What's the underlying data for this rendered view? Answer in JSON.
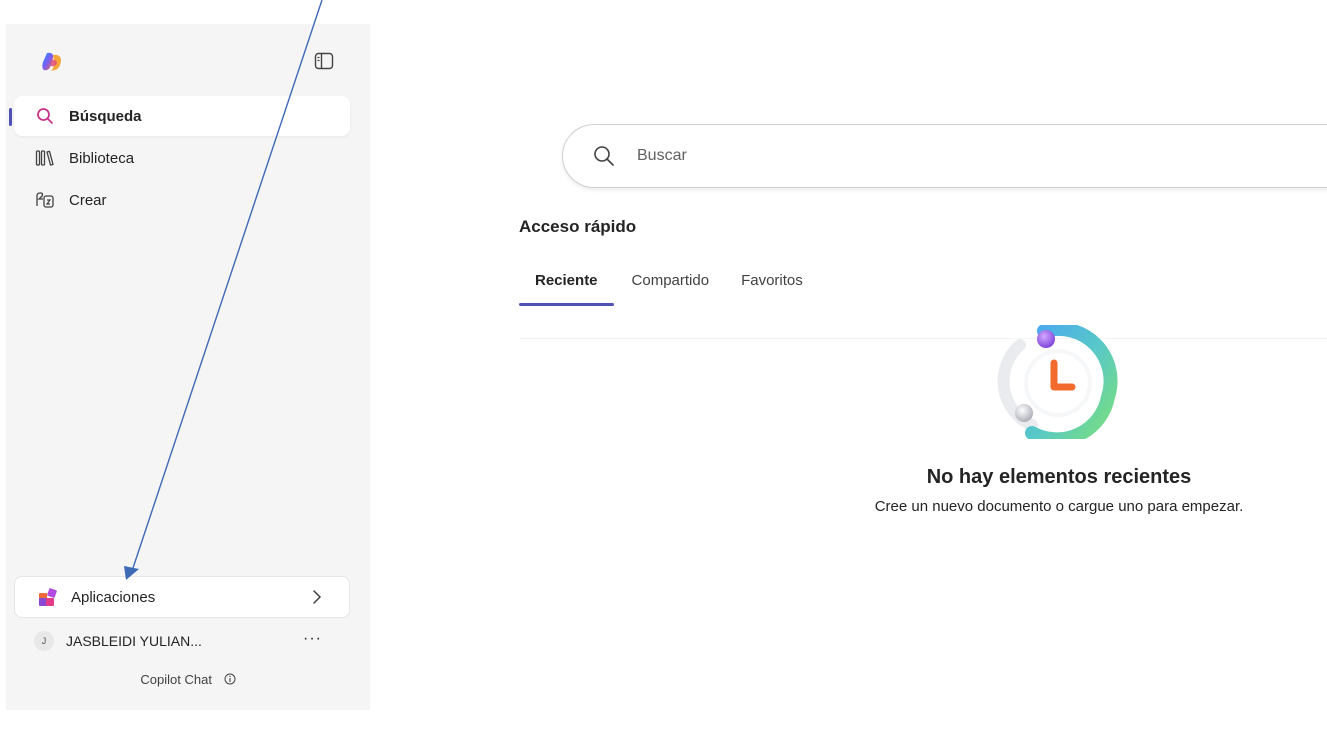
{
  "sidebar": {
    "nav": [
      {
        "label": "Búsqueda",
        "icon": "search-icon"
      },
      {
        "label": "Biblioteca",
        "icon": "library-icon"
      },
      {
        "label": "Crear",
        "icon": "create-icon"
      }
    ],
    "apps_label": "Aplicaciones",
    "user": {
      "initial": "J",
      "name": "JASBLEIDI YULIAN..."
    },
    "footer": "Copilot Chat"
  },
  "main": {
    "search_placeholder": "Buscar",
    "quick_access_title": "Acceso rápido",
    "tabs": [
      {
        "label": "Reciente",
        "active": true
      },
      {
        "label": "Compartido",
        "active": false
      },
      {
        "label": "Favoritos",
        "active": false
      }
    ],
    "empty": {
      "title": "No hay elementos recientes",
      "subtitle": "Cree un nuevo documento o cargue uno para empezar."
    }
  },
  "colors": {
    "accent": "#4f52b2",
    "search_icon_active": "#c8338a",
    "annotation_arrow": "#3d6ab5"
  }
}
